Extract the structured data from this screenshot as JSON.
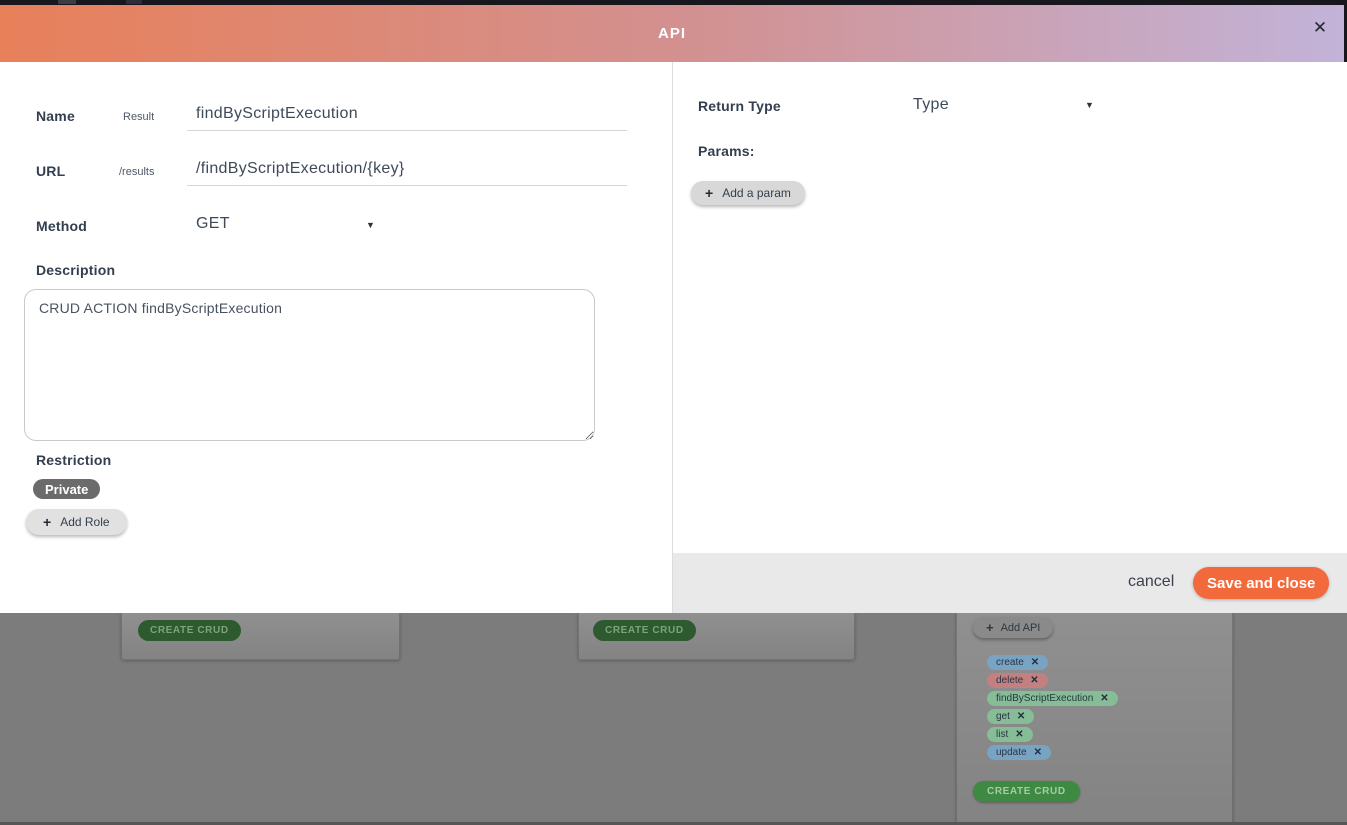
{
  "modal": {
    "title": "API",
    "close_icon": "✕",
    "dropdown_arrow": "▼",
    "header_gradient": {
      "from": "#e8805a",
      "mid": "#d29191",
      "to": "#c2b3d9"
    },
    "fields": {
      "name": {
        "label": "Name",
        "hint": "Result",
        "value": "findByScriptExecution"
      },
      "url": {
        "label": "URL",
        "hint": "/results",
        "value": "/findByScriptExecution/{key}"
      },
      "method": {
        "label": "Method",
        "value": "GET"
      },
      "description": {
        "label": "Description",
        "value": "CRUD ACTION findByScriptExecution"
      },
      "restriction": {
        "label": "Restriction",
        "badge": "Private",
        "add_role": "Add Role",
        "plus_icon": "+"
      }
    },
    "right_panel": {
      "return_type_label": "Return Type",
      "return_type_value": "Type",
      "params_label": "Params:",
      "add_param": "Add a param",
      "plus_icon": "+"
    },
    "footer": {
      "cancel": "cancel",
      "save": "Save and close",
      "save_color": "#f2693c"
    }
  },
  "background_page": {
    "create_crud": "CREATE CRUD",
    "add_api": "Add API",
    "plus_icon": "+",
    "remove_icon": "✕",
    "tags": [
      {
        "label": "create",
        "color": "#79a3c3"
      },
      {
        "label": "delete",
        "color": "#c28080"
      },
      {
        "label": "findByScriptExecution",
        "color": "#86bc96"
      },
      {
        "label": "get",
        "color": "#86bc96"
      },
      {
        "label": "list",
        "color": "#86bc96"
      },
      {
        "label": "update",
        "color": "#79a3c3"
      }
    ]
  }
}
